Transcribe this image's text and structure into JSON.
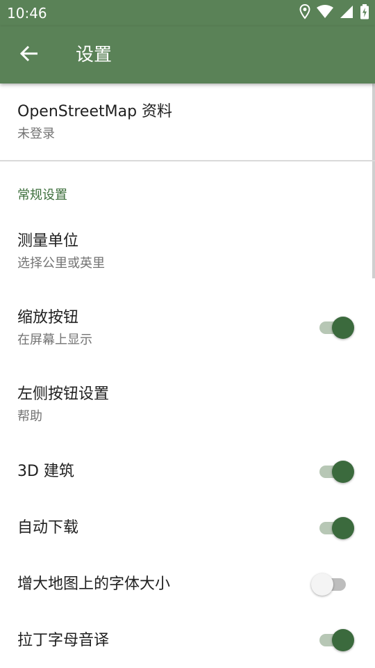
{
  "status_bar": {
    "time": "10:46",
    "icons": [
      "location-icon",
      "wifi-icon",
      "signal-icon",
      "battery-charging-icon"
    ]
  },
  "app_bar": {
    "back_icon": "arrow-back-icon",
    "title": "设置"
  },
  "colors": {
    "primary": "#5a8257",
    "accent": "#3b6a3d",
    "section_header": "#3c6e3b",
    "switch_on_thumb": "#3b6a3d",
    "switch_on_track": "#b7c7b5",
    "switch_off_thumb": "#f4f4f4",
    "switch_off_track": "#bdbdbd"
  },
  "osm_profile": {
    "title": "OpenStreetMap 资料",
    "subtitle": "未登录"
  },
  "general_section": {
    "header": "常规设置",
    "items": [
      {
        "title": "测量单位",
        "subtitle": "选择公里或英里"
      },
      {
        "title": "缩放按钮",
        "subtitle": "在屏幕上显示",
        "toggle": true
      },
      {
        "title": "左侧按钮设置",
        "subtitle": "帮助"
      },
      {
        "title": "3D 建筑",
        "toggle": true
      },
      {
        "title": "自动下载",
        "toggle": true
      },
      {
        "title": "增大地图上的字体大小",
        "toggle": false
      },
      {
        "title": "拉丁字母音译",
        "toggle": true
      }
    ]
  }
}
